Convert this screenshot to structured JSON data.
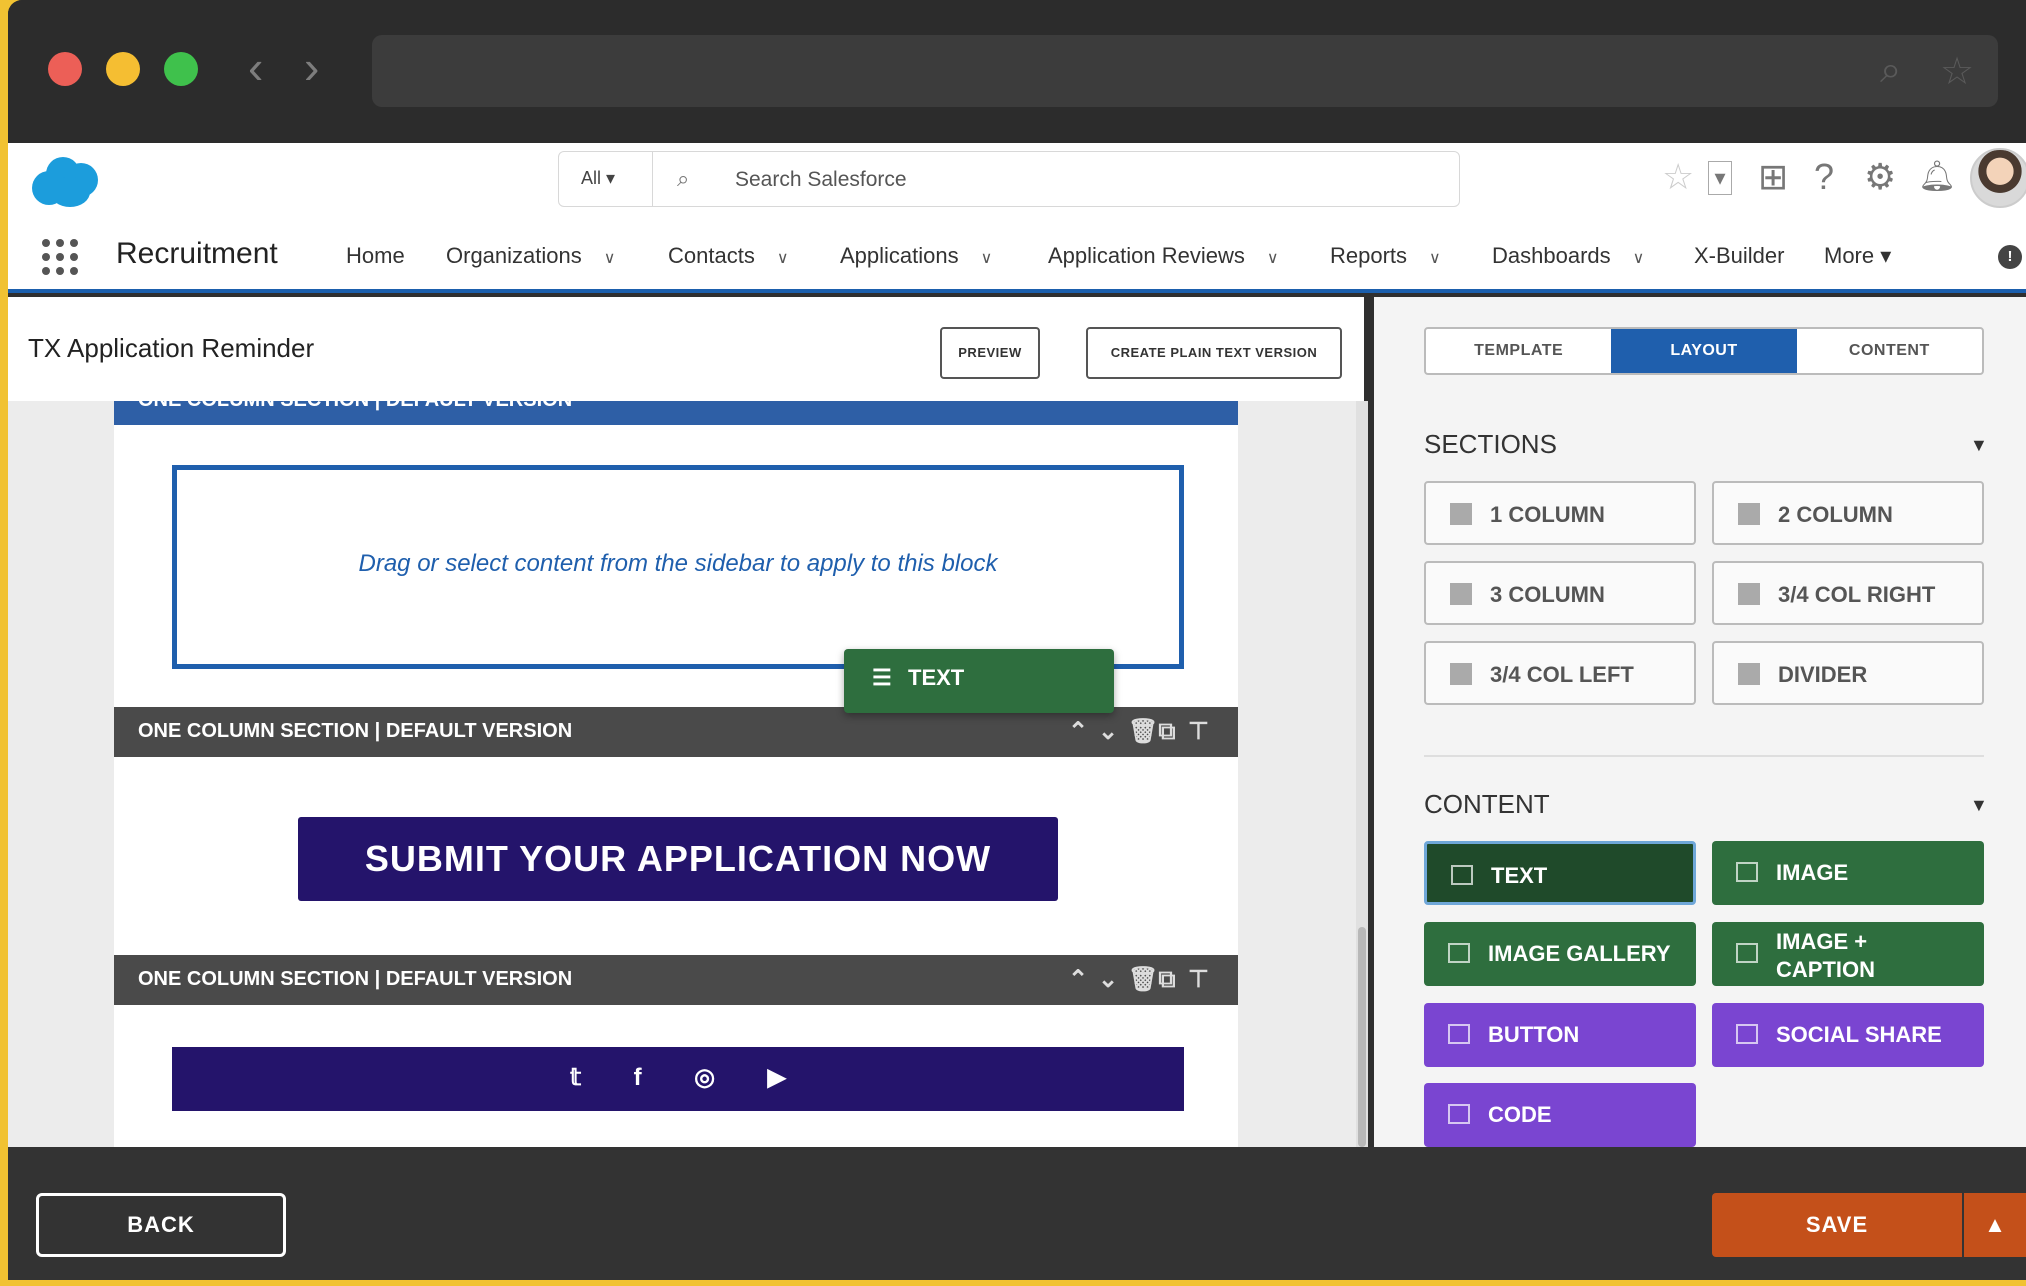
{
  "search": {
    "scope": "All ▾",
    "placeholder": "Search Salesforce"
  },
  "header_icons": {
    "favorites": "star-icon",
    "add": "plus-icon",
    "help": "?",
    "setup": "gear-icon",
    "notifications": "bell-icon"
  },
  "app": {
    "name": "Recruitment",
    "nav": [
      {
        "label": "Home",
        "dropdown": false
      },
      {
        "label": "Organizations",
        "dropdown": true
      },
      {
        "label": "Contacts",
        "dropdown": true
      },
      {
        "label": "Applications",
        "dropdown": true
      },
      {
        "label": "Application Reviews",
        "dropdown": true
      },
      {
        "label": "Reports",
        "dropdown": true
      },
      {
        "label": "Dashboards",
        "dropdown": true
      },
      {
        "label": "X-Builder",
        "dropdown": false
      },
      {
        "label": "More ▾",
        "dropdown": false
      }
    ]
  },
  "editor": {
    "title": "TX Application Reminder",
    "preview_label": "PREVIEW",
    "plain_text_label": "CREATE PLAIN TEXT VERSION",
    "sections": [
      {
        "label": "ONE COLUMN SECTION | DEFAULT VERSION"
      },
      {
        "label": "ONE COLUMN SECTION | DEFAULT VERSION"
      },
      {
        "label": "ONE COLUMN SECTION | DEFAULT VERSION"
      }
    ],
    "dropzone_text": "Drag or select content from the sidebar to apply to this block",
    "drag_ghost_label": "TEXT",
    "submit_button_label": "SUBMIT YOUR APPLICATION NOW",
    "social_icons": [
      "twitter-icon",
      "facebook-icon",
      "instagram-icon",
      "youtube-icon"
    ]
  },
  "sidebar": {
    "tabs": [
      {
        "label": "TEMPLATE",
        "active": false
      },
      {
        "label": "LAYOUT",
        "active": true
      },
      {
        "label": "CONTENT",
        "active": false
      }
    ],
    "sections_heading": "SECTIONS",
    "layouts": [
      "1 COLUMN",
      "2 COLUMN",
      "3 COLUMN",
      "3/4 COL RIGHT",
      "3/4 COL LEFT",
      "DIVIDER"
    ],
    "content_heading": "CONTENT",
    "content_items": [
      {
        "label": "TEXT",
        "style": "dkgreen"
      },
      {
        "label": "IMAGE",
        "style": "green"
      },
      {
        "label": "IMAGE GALLERY",
        "style": "green"
      },
      {
        "label": "IMAGE + CAPTION",
        "style": "green"
      },
      {
        "label": "BUTTON",
        "style": "purple"
      },
      {
        "label": "SOCIAL SHARE",
        "style": "purple"
      },
      {
        "label": "CODE",
        "style": "purple"
      }
    ]
  },
  "footer": {
    "back_label": "BACK",
    "save_label": "SAVE"
  },
  "colors": {
    "brand_blue": "#1f5fad",
    "green": "#2e6e3e",
    "purple": "#7a45d1",
    "save_orange": "#c4501a",
    "email_navy": "#24146b"
  }
}
